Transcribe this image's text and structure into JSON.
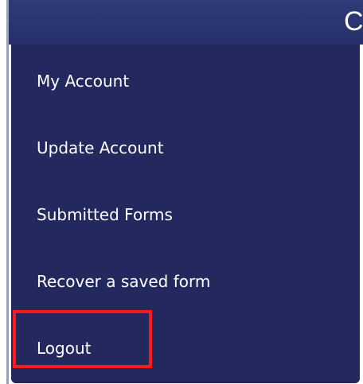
{
  "header": {
    "title_fragment": "Ci"
  },
  "menu": {
    "items": [
      {
        "label": "My Account"
      },
      {
        "label": "Update Account"
      },
      {
        "label": "Submitted Forms"
      },
      {
        "label": "Recover a saved form"
      },
      {
        "label": "Logout"
      }
    ]
  },
  "colors": {
    "menu_background": "#23295f",
    "header_background": "#2b3470",
    "menu_text": "#ffffff",
    "highlight_border": "#ff1a1a"
  }
}
